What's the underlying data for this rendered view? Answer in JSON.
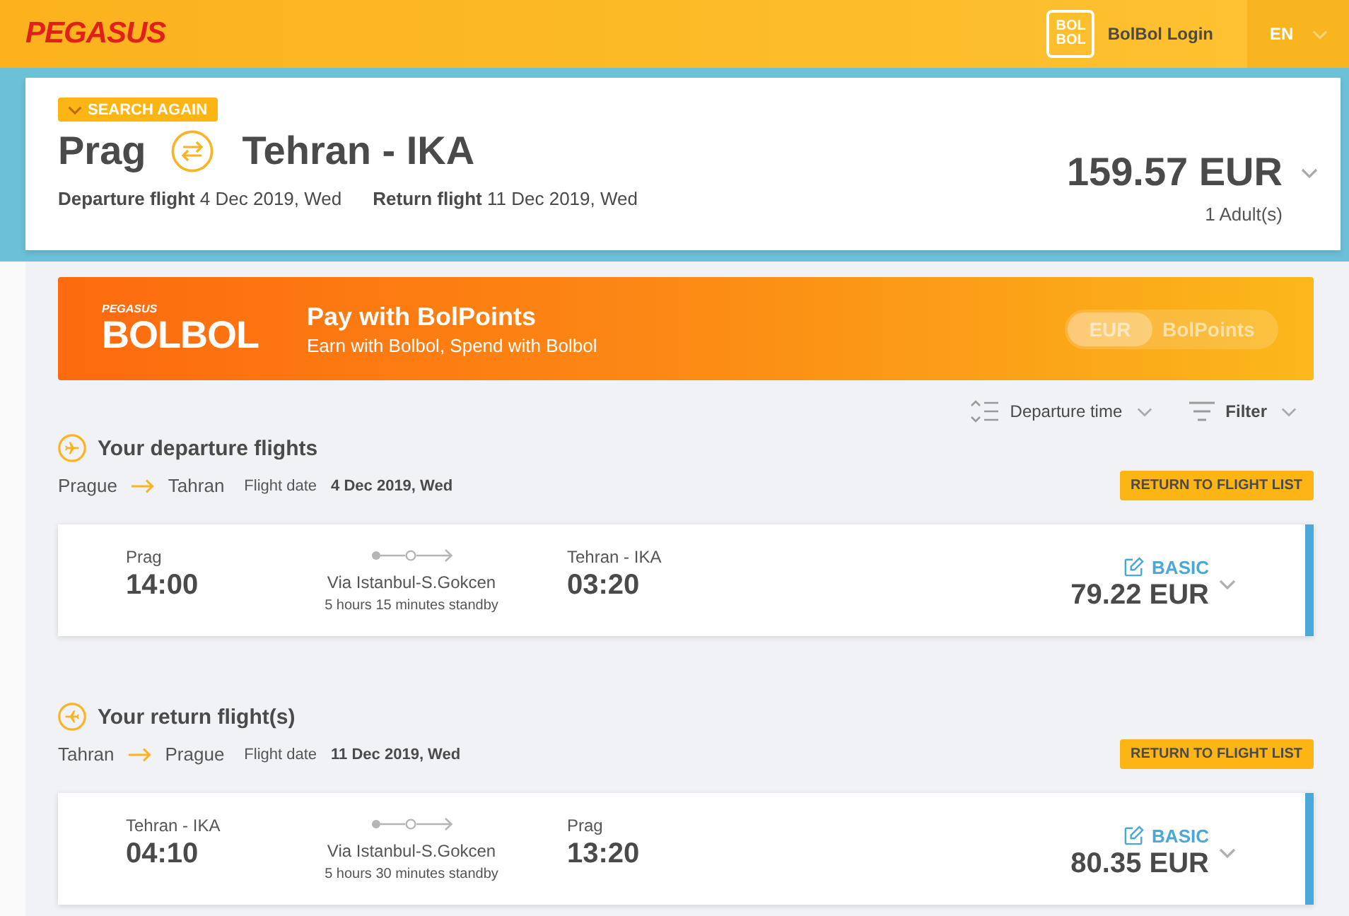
{
  "header": {
    "logo": "PEGASUS",
    "loyalty_logo": [
      "BOL",
      "BOL"
    ],
    "login": "BolBol Login",
    "language": "EN"
  },
  "summary": {
    "search_again": "SEARCH AGAIN",
    "origin": "Prag",
    "destination": "Tehran - IKA",
    "departure": "**Departure flight** 4 Dec 2019, Wed",
    "return": "**Return flight** 11 Dec 2019, Wed",
    "total": "159.57 EUR",
    "passengers": "1 Adult(s)"
  },
  "banner": {
    "logo_tagline": "PEGASUS",
    "logo": "BOLBOL",
    "title": "Pay with BolPoints",
    "subtitle": "Earn with Bolbol, Spend with Bolbol",
    "currency_toggle": [
      {
        "label": "EUR",
        "selected": true
      },
      {
        "label": "BolPoints",
        "selected": false
      }
    ]
  },
  "toolbar": {
    "sort": "Departure time",
    "filter": "Filter"
  },
  "sections": [
    {
      "kind": "departure",
      "title": "Your departure flights",
      "from": "Prague",
      "to": "Tahran",
      "date_label": "Flight date",
      "date": "4 Dec 2019, Wed",
      "button": "RETURN TO FLIGHT LIST",
      "flights": [
        {
          "origin": "Prag",
          "departure_time": "14:00",
          "via": "Via Istanbul-S.Gokcen",
          "standby": "5 hours 15 minutes standby",
          "destination": "Tehran - IKA",
          "arrival_time": "03:20",
          "fare": "BASIC",
          "price": "79.22 EUR",
          "selected": true
        }
      ]
    },
    {
      "kind": "return",
      "title": "Your return flight(s)",
      "from": "Tahran",
      "to": "Prague",
      "date_label": "Flight date",
      "date": "11 Dec 2019, Wed",
      "button": "RETURN TO FLIGHT LIST",
      "flights": [
        {
          "origin": "Tehran - IKA",
          "departure_time": "04:10",
          "via": "Via Istanbul-S.Gokcen",
          "standby": "5 hours 30 minutes standby",
          "destination": "Prag",
          "arrival_time": "13:20",
          "fare": "BASIC",
          "price": "80.35 EUR",
          "selected": true
        }
      ]
    }
  ]
}
